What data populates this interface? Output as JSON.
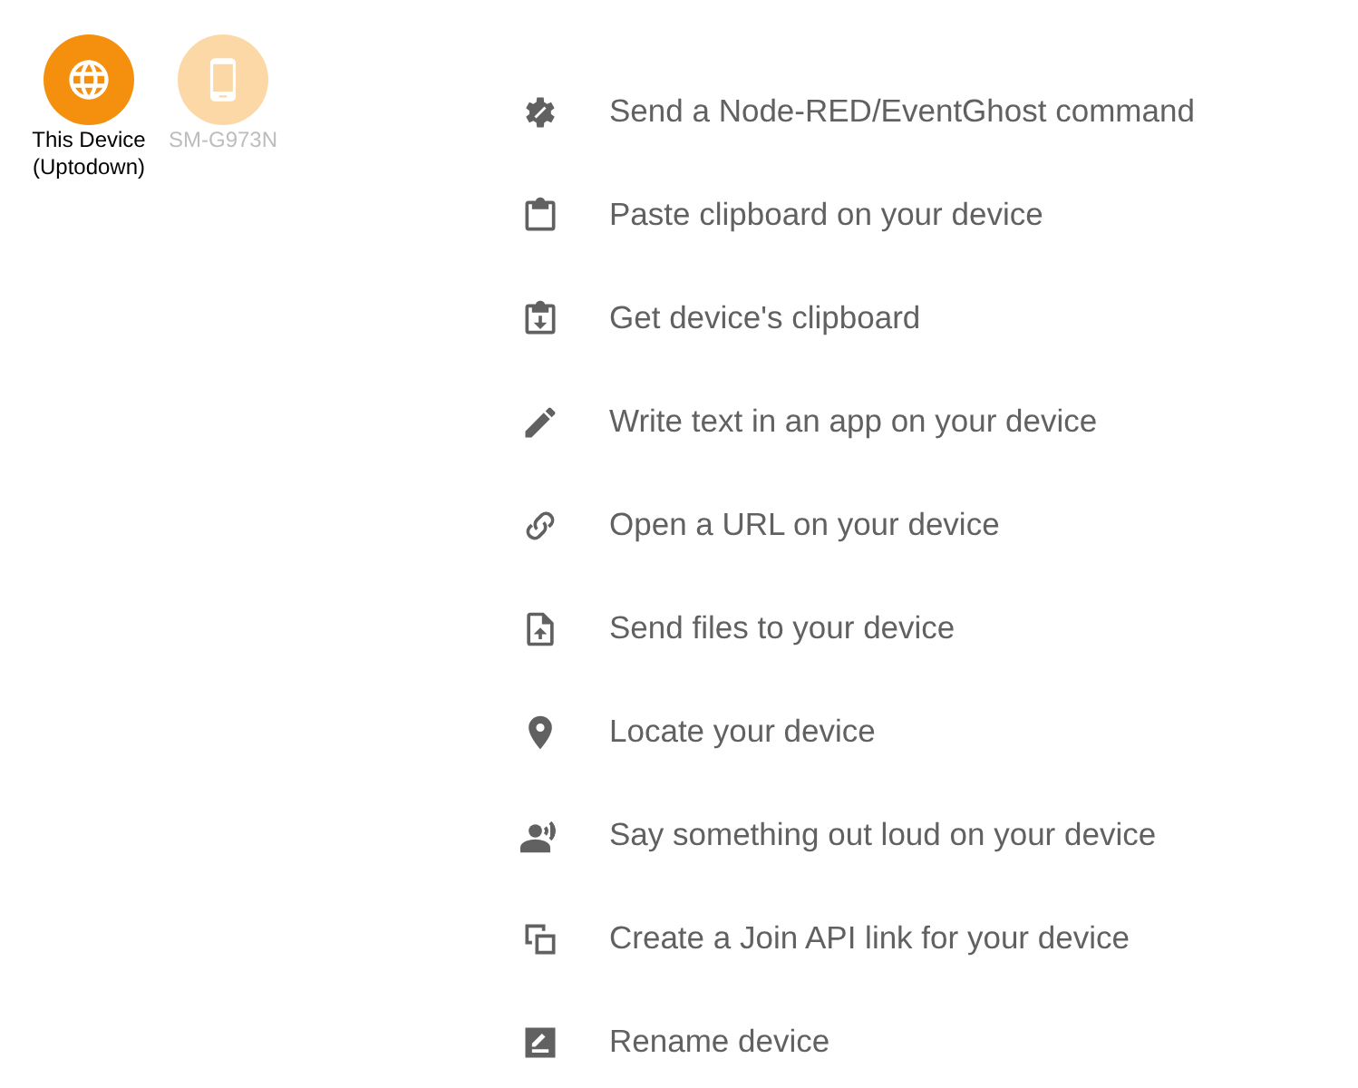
{
  "devices": [
    {
      "name": "This Device (Uptodown)",
      "kind": "web",
      "selected": true
    },
    {
      "name": "SM-G973N",
      "kind": "phone",
      "selected": false
    }
  ],
  "actions": [
    {
      "label": "Send a Node-RED/EventGhost command",
      "kind": "gear"
    },
    {
      "label": "Paste clipboard on your device",
      "kind": "clipboard"
    },
    {
      "label": "Get device's clipboard",
      "kind": "clipboard-down"
    },
    {
      "label": "Write text in an app on your device",
      "kind": "pencil"
    },
    {
      "label": "Open a URL on your device",
      "kind": "link"
    },
    {
      "label": "Send files to your device",
      "kind": "file-up"
    },
    {
      "label": "Locate your device",
      "kind": "pin"
    },
    {
      "label": "Say something out loud on your device",
      "kind": "speak"
    },
    {
      "label": "Create a Join API link for your device",
      "kind": "copy"
    },
    {
      "label": "Rename device",
      "kind": "rename"
    }
  ]
}
